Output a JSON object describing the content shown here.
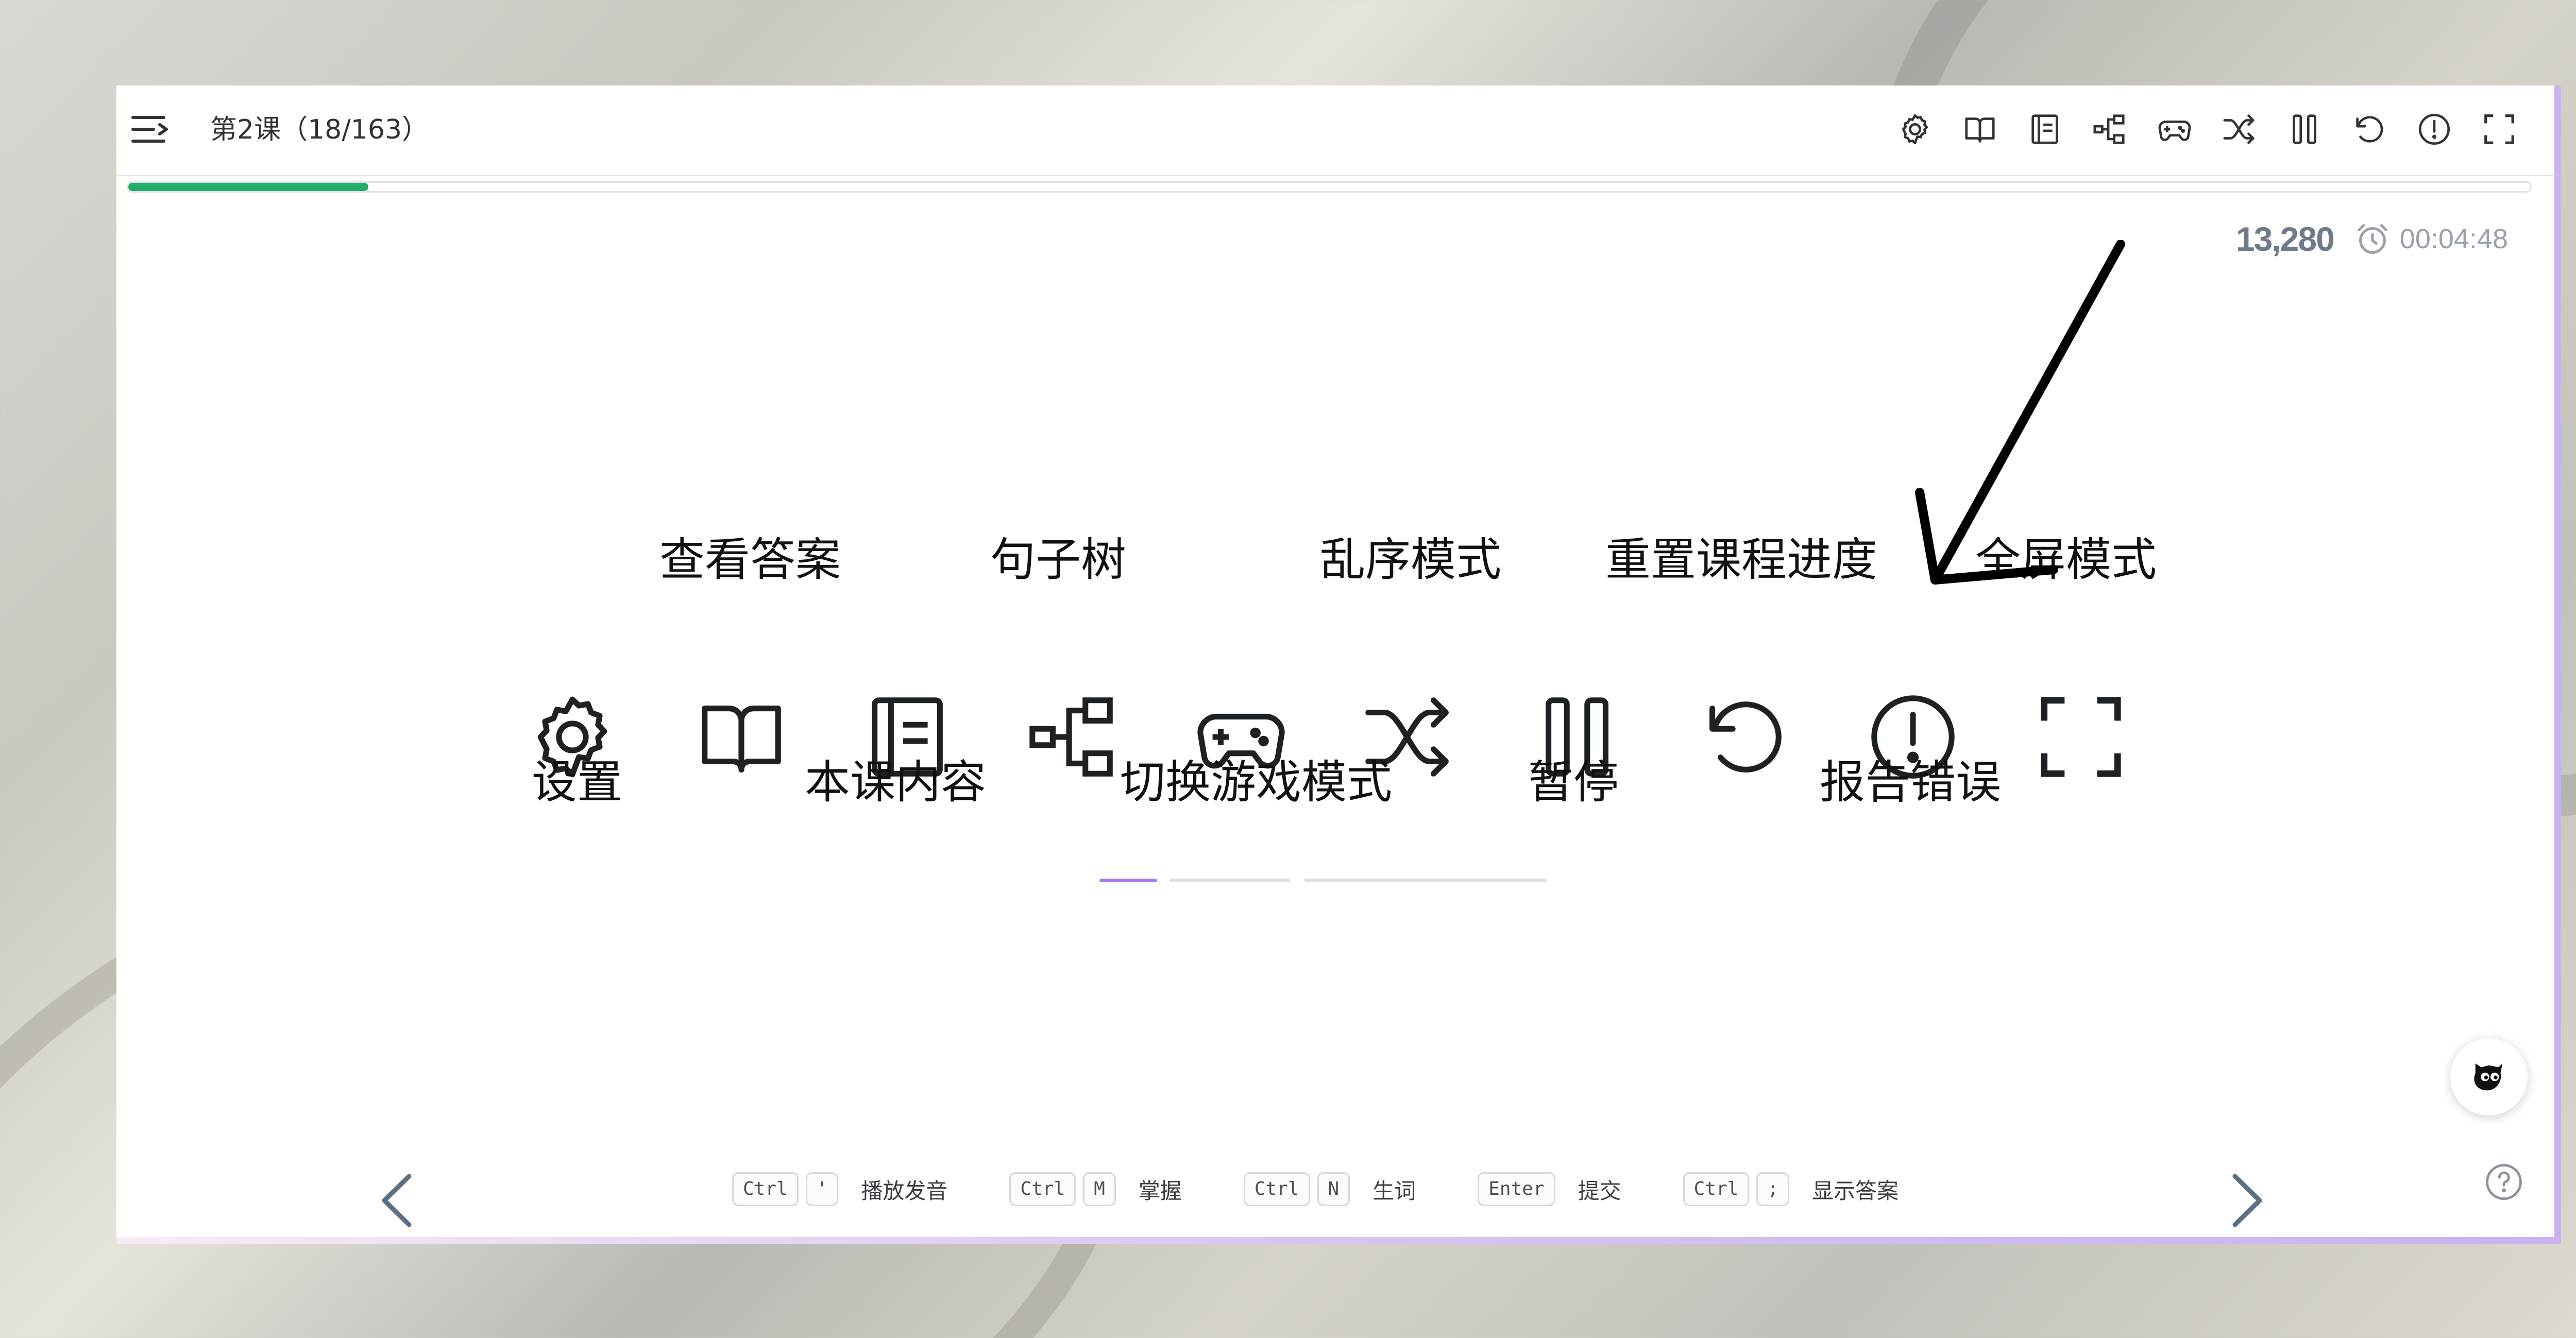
{
  "header": {
    "lesson_title": "第2课（18/163）"
  },
  "toolbar": {
    "icons": [
      "gear-icon",
      "open-book-icon",
      "document-icon",
      "sentence-tree-icon",
      "gamepad-icon",
      "shuffle-icon",
      "pause-icon",
      "undo-icon",
      "alert-icon",
      "fullscreen-icon"
    ]
  },
  "progress": {
    "fraction": 0.1
  },
  "stats": {
    "score": "13,280",
    "timer": "00:04:48"
  },
  "legend": {
    "settings": "设置",
    "view_answer": "查看答案",
    "lesson_content": "本课内容",
    "sentence_tree": "句子树",
    "game_mode": "切换游戏模式",
    "shuffle_mode": "乱序模式",
    "pause": "暂停",
    "reset_progress": "重置课程进度",
    "report_error": "报告错误",
    "fullscreen": "全屏模式"
  },
  "shortcuts": [
    {
      "keys": [
        "Ctrl",
        "'"
      ],
      "label": "播放发音"
    },
    {
      "keys": [
        "Ctrl",
        "M"
      ],
      "label": "掌握"
    },
    {
      "keys": [
        "Ctrl",
        "N"
      ],
      "label": "生词"
    },
    {
      "keys": [
        "Enter"
      ],
      "label": "提交"
    },
    {
      "keys": [
        "Ctrl",
        ";"
      ],
      "label": "显示答案"
    }
  ],
  "colors": {
    "accent_green": "#1fae6b",
    "accent_purple": "#a77af0",
    "text_dark": "#2f3338"
  }
}
